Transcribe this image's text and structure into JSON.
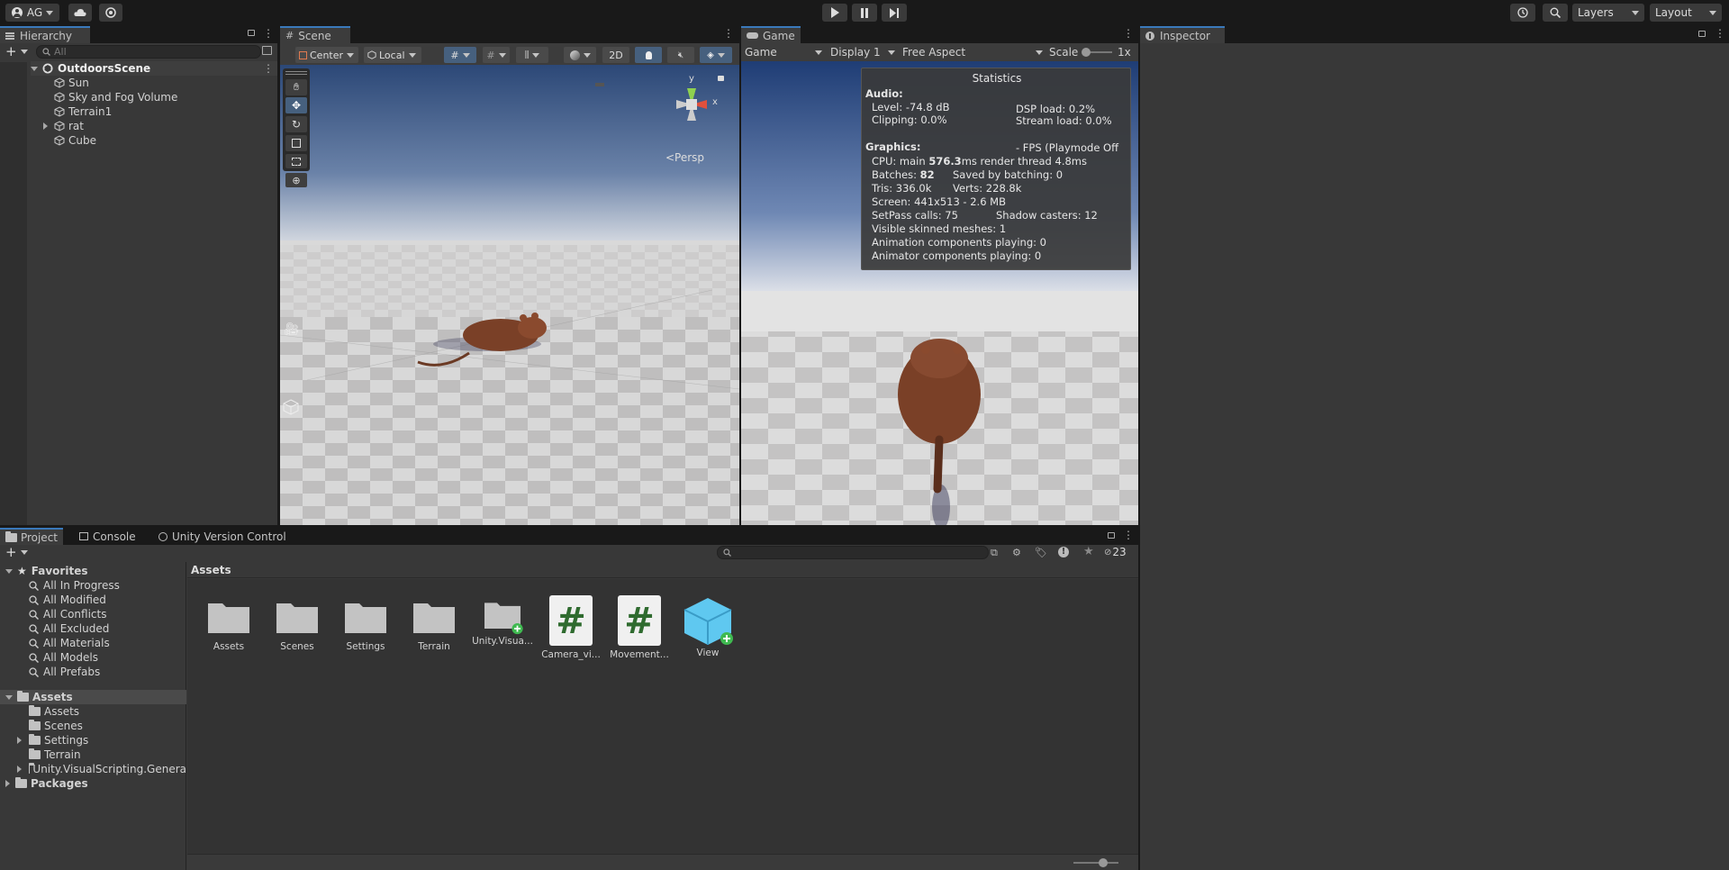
{
  "toolbar": {
    "account": "AG",
    "layers": "Layers",
    "layout": "Layout"
  },
  "hierarchy": {
    "tab": "Hierarchy",
    "search_placeholder": "All",
    "scene": "OutdoorsScene",
    "items": [
      "Sun",
      "Sky and Fog Volume",
      "Terrain1",
      "rat",
      "Cube"
    ]
  },
  "scene_view": {
    "tab": "Scene",
    "pivot": "Center",
    "space": "Local",
    "mode_2d": "2D",
    "persp": "<Persp",
    "gizmo_y": "y",
    "gizmo_x": "x"
  },
  "game_view": {
    "tab": "Game",
    "mode": "Game",
    "display": "Display 1",
    "aspect": "Free Aspect",
    "scale_label": "Scale",
    "scale_value": "1x",
    "stats": {
      "title": "Statistics",
      "audio_header": "Audio:",
      "level": "Level: -74.8 dB",
      "dsp": "DSP load: 0.2%",
      "clipping": "Clipping: 0.0%",
      "stream": "Stream load: 0.0%",
      "graphics_header": "Graphics:",
      "fps": "- FPS (Playmode Off",
      "cpu_pre": "CPU: main ",
      "cpu_val": "576.3",
      "cpu_post": "ms  render thread 4.8ms",
      "batches_pre": "Batches: ",
      "batches_val": "82",
      "saved": "Saved by batching: 0",
      "tris": "Tris: 336.0k",
      "verts": "Verts: 228.8k",
      "screen": "Screen: 441x513 - 2.6 MB",
      "setpass": "SetPass calls: 75",
      "shadow": "Shadow casters: 12",
      "skinned": "Visible skinned meshes: 1",
      "anim": "Animation components playing: 0",
      "animator": "Animator components playing: 0"
    }
  },
  "inspector": {
    "tab": "Inspector"
  },
  "project": {
    "tabs": [
      "Project",
      "Console",
      "Unity Version Control"
    ],
    "hidden_count": "23",
    "favorites_header": "Favorites",
    "favorites": [
      "All In Progress",
      "All Modified",
      "All Conflicts",
      "All Excluded",
      "All Materials",
      "All Models",
      "All Prefabs"
    ],
    "assets_header": "Assets",
    "tree": [
      "Assets",
      "Scenes",
      "Settings",
      "Terrain",
      "Unity.VisualScripting.Genera"
    ],
    "packages": "Packages",
    "breadcrumb": "Assets",
    "grid": [
      {
        "label": "Assets",
        "kind": "folder"
      },
      {
        "label": "Scenes",
        "kind": "folder"
      },
      {
        "label": "Settings",
        "kind": "folder"
      },
      {
        "label": "Terrain",
        "kind": "folder"
      },
      {
        "label": "Unity.Visua...",
        "kind": "folder-plus"
      },
      {
        "label": "Camera_vi...",
        "kind": "script"
      },
      {
        "label": "Movement...",
        "kind": "script"
      },
      {
        "label": "View",
        "kind": "prefab-plus"
      }
    ],
    "script_glyph": "#"
  },
  "colors": {
    "accent": "#3a79bb",
    "script_green": "#2f6b2f",
    "prefab_blue": "#5fc8f0",
    "plus_green": "#3fb950"
  }
}
